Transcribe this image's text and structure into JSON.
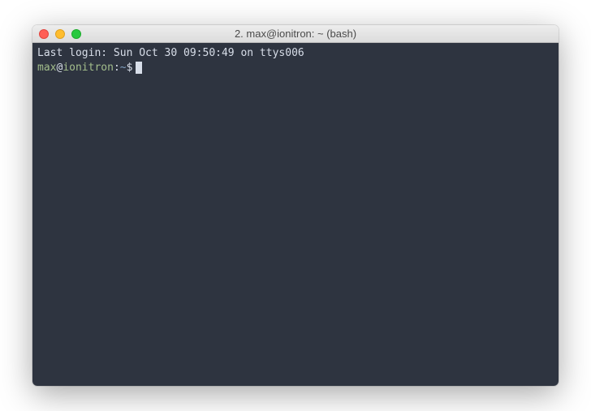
{
  "window": {
    "title": "2. max@ionitron: ~ (bash)"
  },
  "terminal": {
    "last_login": "Last login: Sun Oct 30 09:50:49 on ttys006",
    "prompt": {
      "user": "max",
      "at": "@",
      "host": "ionitron",
      "colon": ":",
      "path": "~",
      "dollar": "$"
    }
  }
}
